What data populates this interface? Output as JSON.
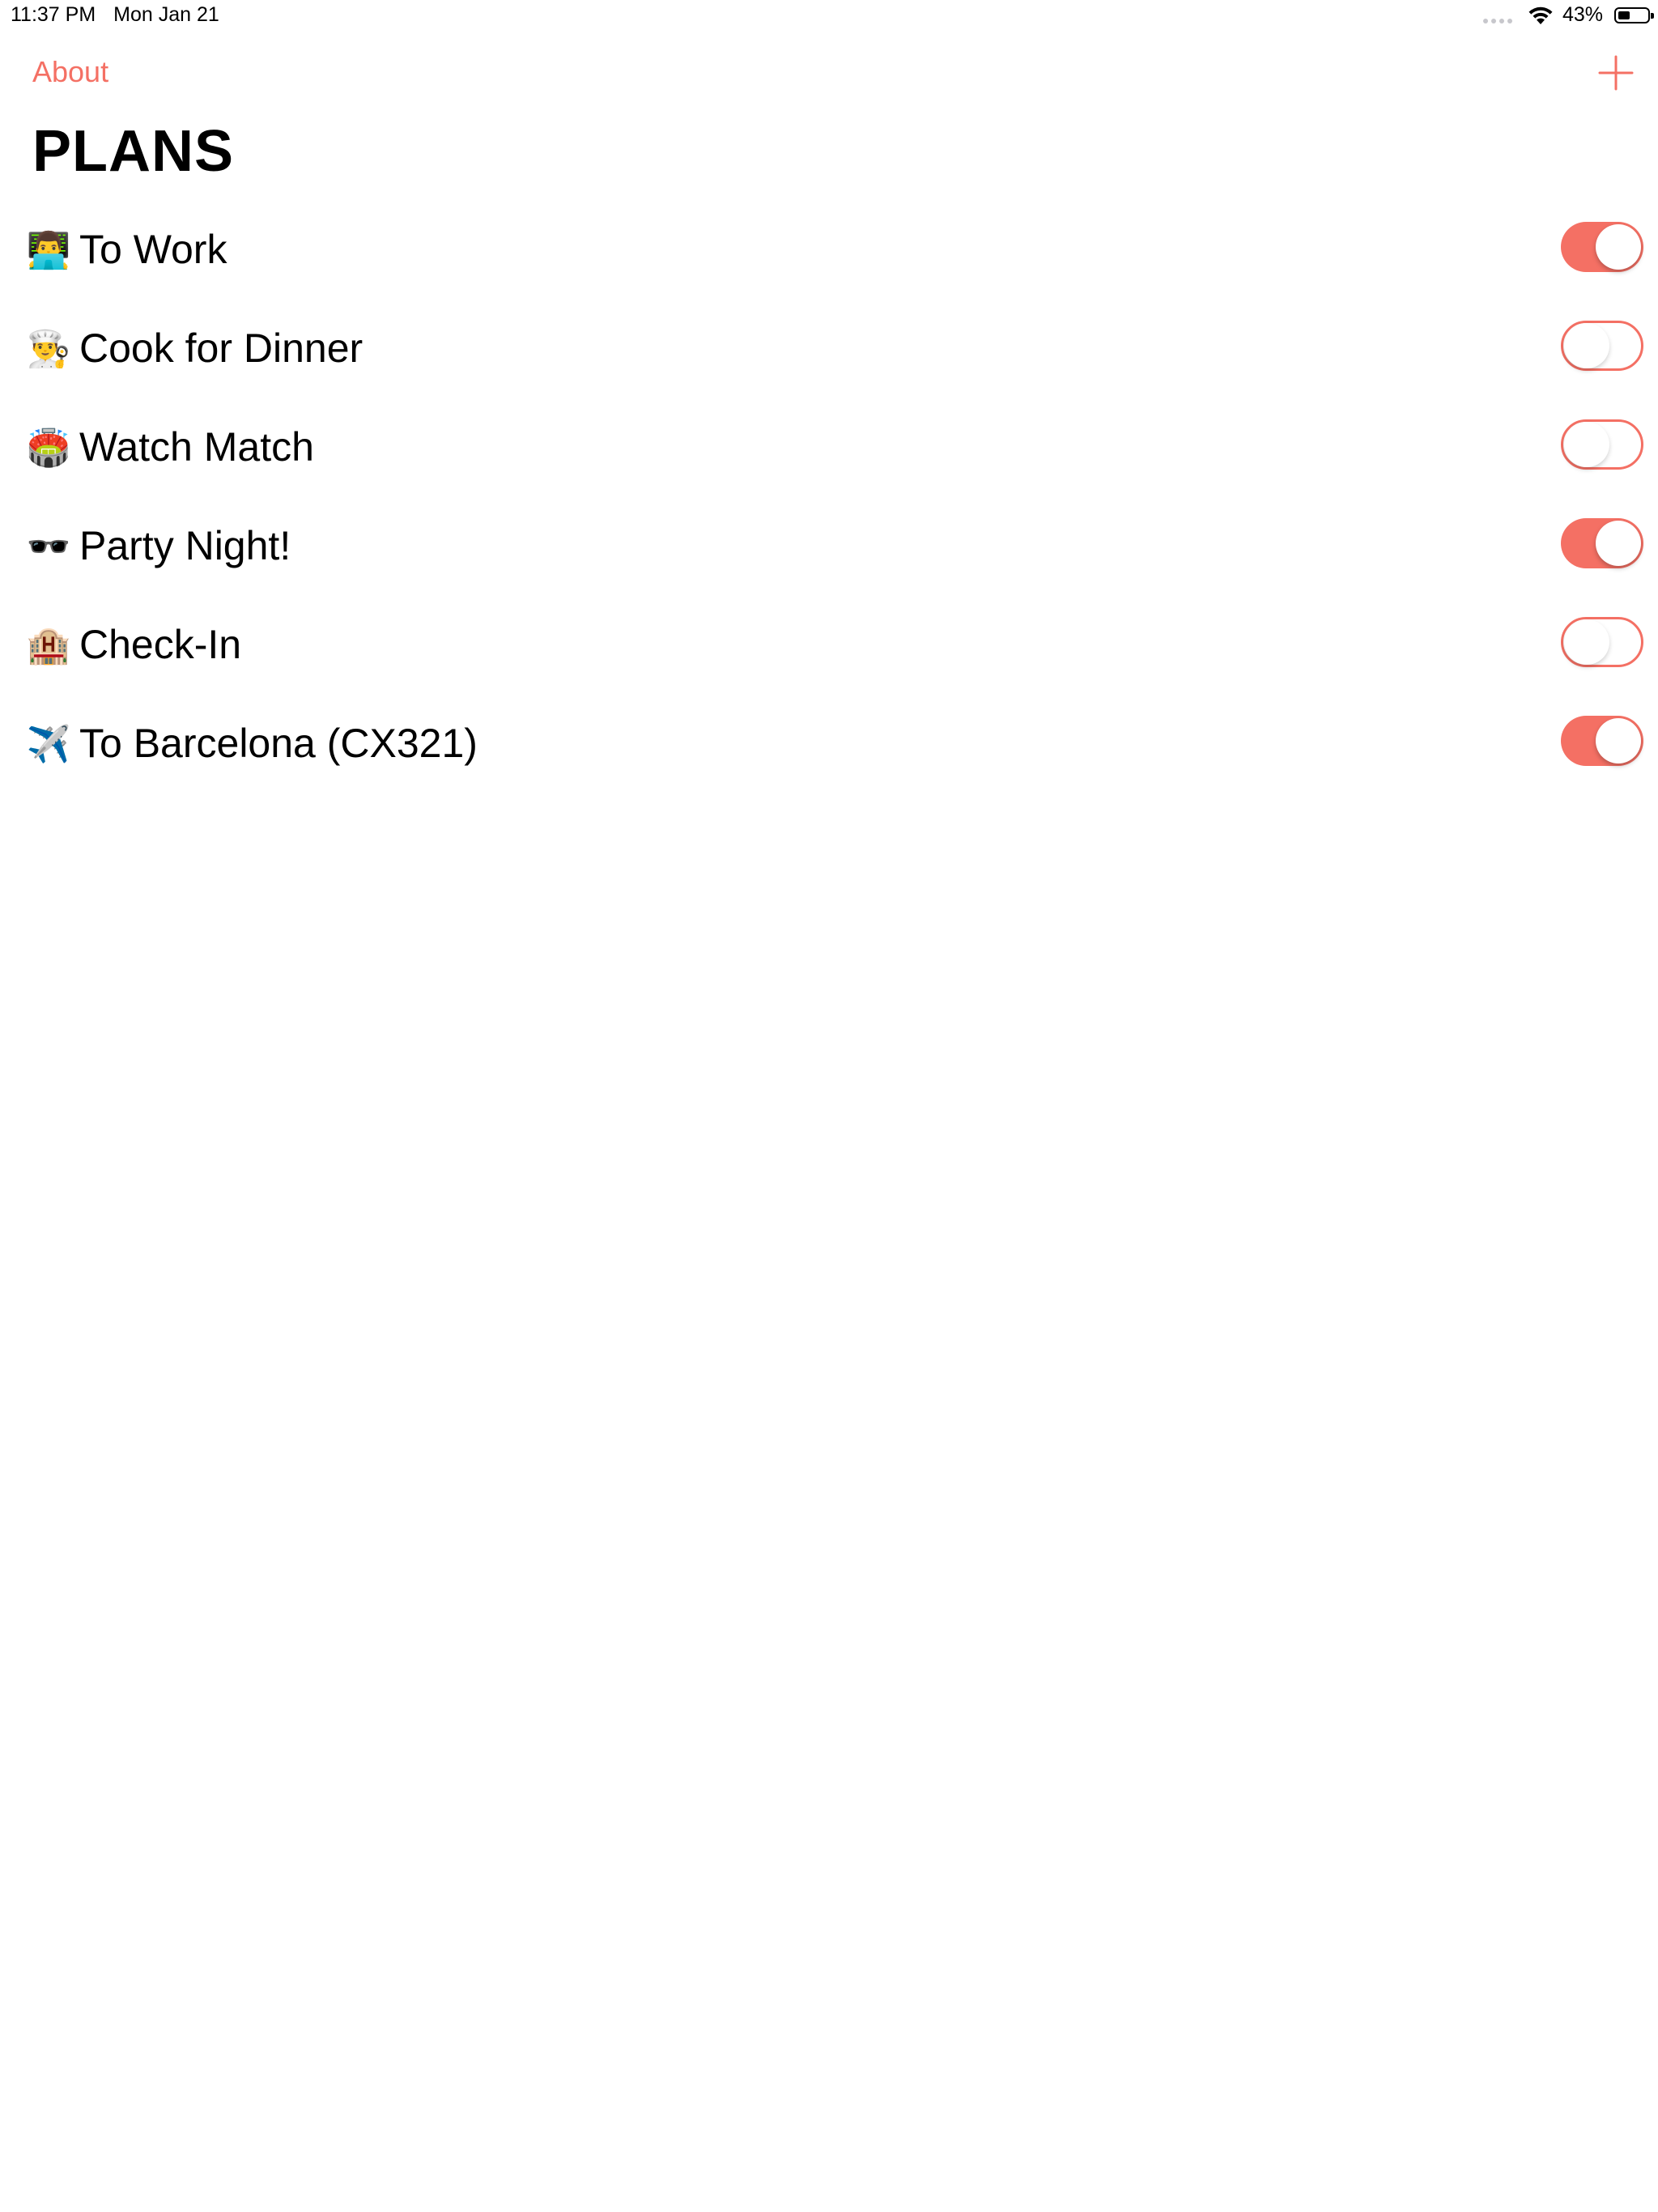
{
  "status_bar": {
    "time": "11:37 PM",
    "date": "Mon Jan 21",
    "battery": "43%"
  },
  "nav": {
    "about_label": "About",
    "add_icon": "plus-icon",
    "title": "PLANS"
  },
  "accent_color": "#f47064",
  "plans": [
    {
      "emoji": "👨‍💻",
      "label": "To Work",
      "enabled": true
    },
    {
      "emoji": "👨‍🍳",
      "label": "Cook for Dinner",
      "enabled": false
    },
    {
      "emoji": "🏟️",
      "label": "Watch Match",
      "enabled": false
    },
    {
      "emoji": "🕶️",
      "label": "Party Night!",
      "enabled": true
    },
    {
      "emoji": "🏨",
      "label": "Check-In",
      "enabled": false
    },
    {
      "emoji": "✈️",
      "label": "To Barcelona (CX321)",
      "enabled": true
    }
  ]
}
